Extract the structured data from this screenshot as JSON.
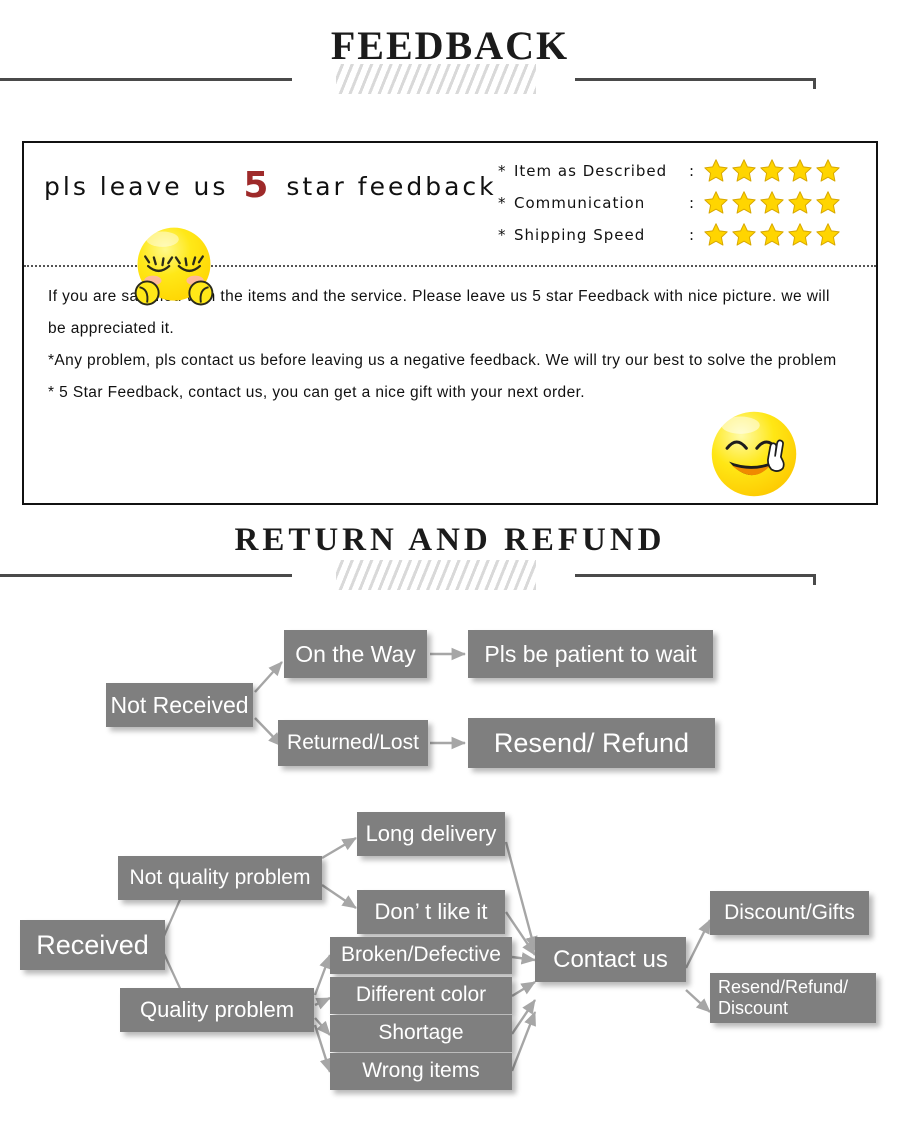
{
  "sections": {
    "feedback_title": "FEEDBACK",
    "return_title": "RETURN  AND  REFUND"
  },
  "feedback": {
    "headline_before": "pls leave us",
    "headline_number": "5",
    "headline_after": "star feedback",
    "ratings": [
      {
        "marker": "*",
        "label": "Item as Described",
        "colon": ":",
        "stars": 5
      },
      {
        "marker": "*",
        "label": "Communication",
        "colon": ":",
        "stars": 5
      },
      {
        "marker": "*",
        "label": "Shipping Speed",
        "colon": ":",
        "stars": 5
      }
    ],
    "body": [
      "If you are satisfied with the items and the service. Please leave us 5 star Feedback with nice picture. we will be appreciated it.",
      "*Any problem, pls contact us before leaving us a negative feedback. We will try our best to solve  the problem",
      "* 5 Star Feedback, contact us, you can get a nice gift with your next order."
    ],
    "emoji_left": "shy-face-emoji",
    "emoji_right": "smiling-peace-sign-emoji"
  },
  "flowchart": {
    "nodes": {
      "not_received": "Not Received",
      "on_the_way": "On the Way",
      "pls_be_patient": "Pls be patient to wait",
      "returned_lost": "Returned/Lost",
      "resend_refund": "Resend/ Refund",
      "received": "Received",
      "not_quality": "Not quality problem",
      "long_delivery": "Long delivery",
      "dont_like": "Don’  t like it",
      "quality_problem": "Quality problem",
      "broken_defective": "Broken/Defective",
      "different_color": "Different color",
      "shortage": "Shortage",
      "wrong_items": "Wrong items",
      "contact_us": "Contact us",
      "discount_gifts": "Discount/Gifts",
      "resend_refund_disc": "Resend/Refund/\nDiscount"
    }
  },
  "colors": {
    "node_fill": "#7f7f7f",
    "node_text": "#ffffff",
    "arrow": "#a6a6a6",
    "star": "#ffd500",
    "accent_red": "#9e2a2a",
    "rule": "#4a4a4a"
  }
}
